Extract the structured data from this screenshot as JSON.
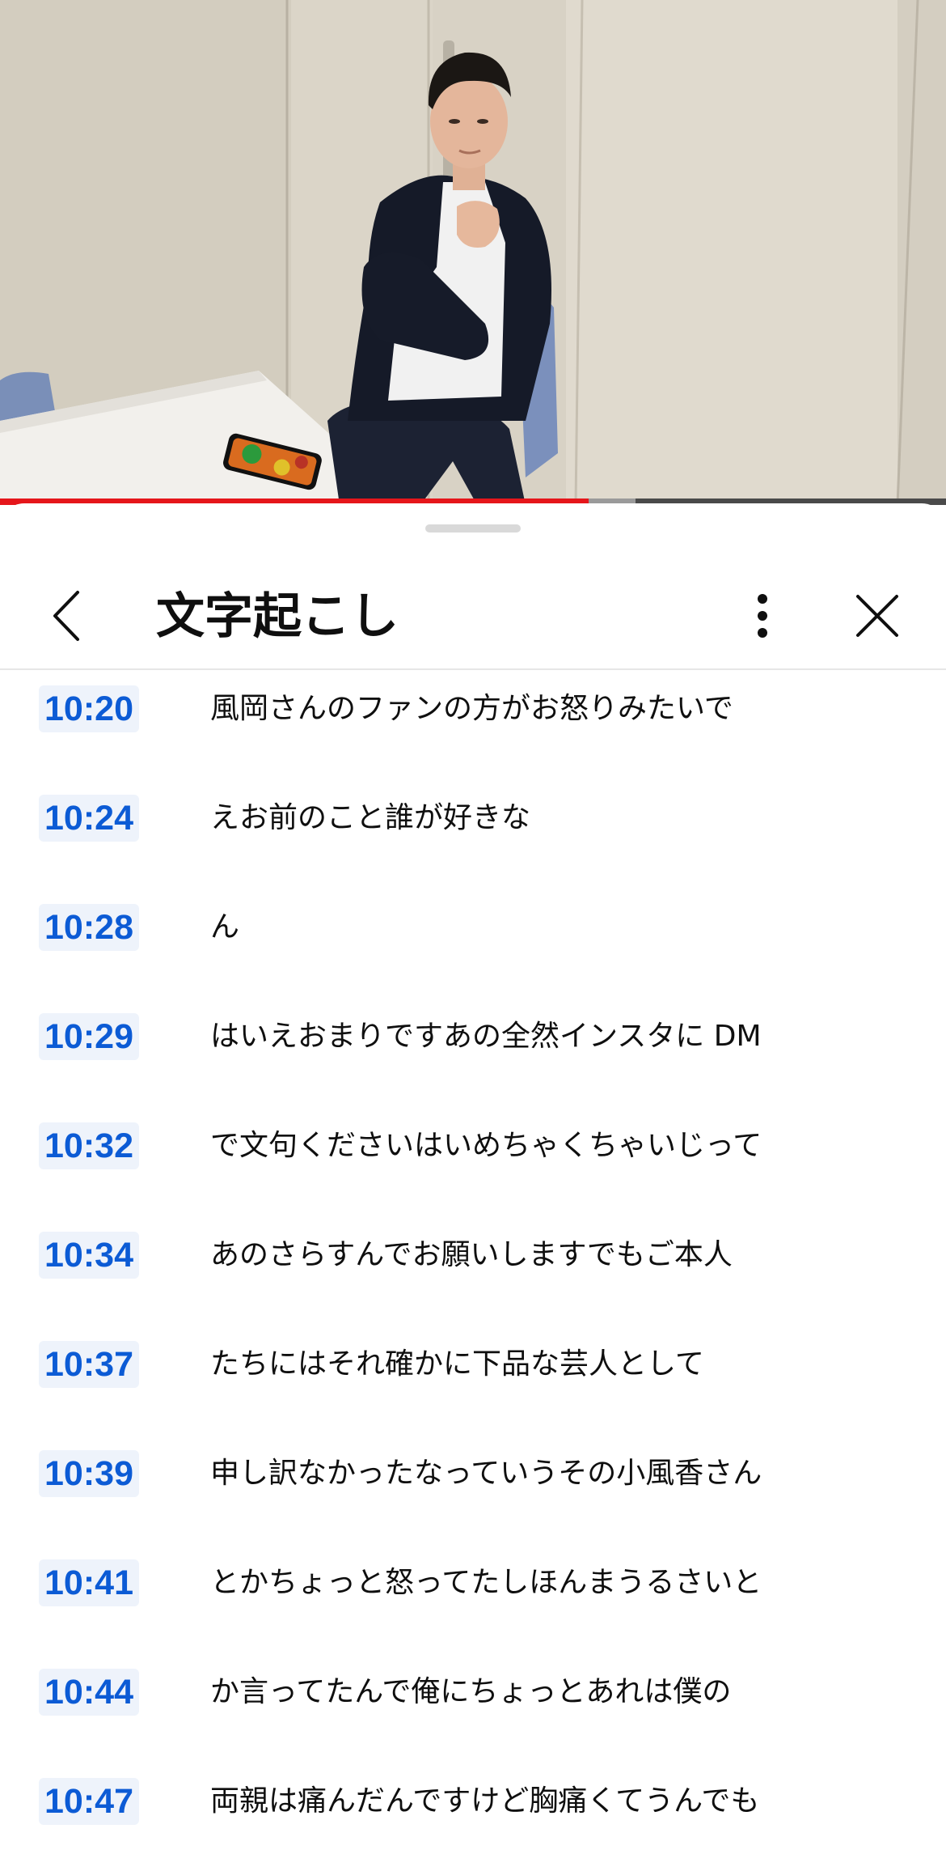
{
  "video": {
    "progress_fraction": 0.622,
    "buffered_fraction": 0.672
  },
  "icons": {
    "back": "chevron-left-icon",
    "more": "more-vertical-icon",
    "close": "close-icon"
  },
  "colors": {
    "progress": "#e5161b",
    "timestamp_text": "#0c5bd5",
    "timestamp_bg": "#eef3fb"
  },
  "transcript": {
    "title": "文字起こし",
    "items": [
      {
        "time": "10:20",
        "text": "風岡さんのファンの方がお怒りみたいで"
      },
      {
        "time": "10:24",
        "text": "えお前のこと誰が好きな"
      },
      {
        "time": "10:28",
        "text": "ん"
      },
      {
        "time": "10:29",
        "text": "はいえおまりですあの全然インスタに DM"
      },
      {
        "time": "10:32",
        "text": "で文句くださいはいめちゃくちゃいじって"
      },
      {
        "time": "10:34",
        "text": "あのさらすんでお願いしますでもご本人"
      },
      {
        "time": "10:37",
        "text": "たちにはそれ確かに下品な芸人として"
      },
      {
        "time": "10:39",
        "text": "申し訳なかったなっていうその小風香さん"
      },
      {
        "time": "10:41",
        "text": "とかちょっと怒ってたしほんまうるさいと"
      },
      {
        "time": "10:44",
        "text": "か言ってたんで俺にちょっとあれは僕の"
      },
      {
        "time": "10:47",
        "text": "両親は痛んだんですけど胸痛くてうんでも"
      }
    ]
  }
}
